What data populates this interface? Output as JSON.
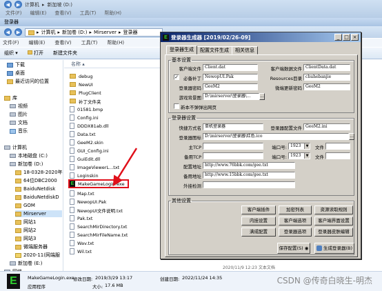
{
  "prev_window": {
    "breadcrumb": [
      "计算机",
      "新加坡 (D:)"
    ],
    "menu": [
      "文件(F)",
      "编辑(E)",
      "查看(V)",
      "工具(T)",
      "帮助(H)"
    ]
  },
  "explorer": {
    "title": "登录器",
    "breadcrumb": [
      "计算机",
      "新加卷 (D:)",
      "Mirserver",
      "登录器"
    ],
    "menu": [
      "文件(F)",
      "编辑(E)",
      "查看(V)",
      "工具(T)",
      "帮助(H)"
    ],
    "toolbar": [
      "组织",
      "打开",
      "新建文件夹"
    ],
    "nav_items": [
      {
        "label": "下载",
        "icon": "folder-blue-icon"
      },
      {
        "label": "桌面",
        "icon": "folder-blue-icon"
      },
      {
        "label": "最近访问的位置",
        "icon": "folder-icon"
      },
      {
        "label": "库",
        "icon": "library-icon"
      },
      {
        "label": "视频",
        "icon": "video-icon"
      },
      {
        "label": "图片",
        "icon": "picture-icon"
      },
      {
        "label": "文档",
        "icon": "document-icon"
      },
      {
        "label": "音乐",
        "icon": "music-icon"
      },
      {
        "label": "计算机",
        "icon": "computer-icon"
      },
      {
        "label": "本地磁盘 (C:)",
        "icon": "drive-icon"
      },
      {
        "label": "新加卷 (D:)",
        "icon": "drive-icon"
      },
      {
        "label": "18-0328-2020年",
        "icon": "folder-icon"
      },
      {
        "label": "64位DBC2000",
        "icon": "folder-icon"
      },
      {
        "label": "BaiduNetdisk",
        "icon": "folder-icon"
      },
      {
        "label": "BaiduNetdiskD",
        "icon": "folder-icon"
      },
      {
        "label": "GOM",
        "icon": "folder-icon"
      },
      {
        "label": "Mirserver",
        "icon": "folder-icon",
        "selected": true
      },
      {
        "label": "网站1",
        "icon": "folder-icon"
      },
      {
        "label": "网站2",
        "icon": "folder-icon"
      },
      {
        "label": "网站3",
        "icon": "folder-icon"
      },
      {
        "label": "微端服务器",
        "icon": "folder-icon"
      },
      {
        "label": "2020-11(网端服",
        "icon": "folder-icon"
      },
      {
        "label": "新加卷 (E:)",
        "icon": "drive-icon"
      },
      {
        "label": "网络",
        "icon": "network-icon"
      }
    ],
    "column_header": "名称",
    "files": [
      {
        "name": "debug",
        "type": "folder"
      },
      {
        "name": "NewUI",
        "type": "folder"
      },
      {
        "name": "PlugClient",
        "type": "folder"
      },
      {
        "name": "补丁文件夹",
        "type": "folder"
      },
      {
        "name": "01581.bmp",
        "type": "file"
      },
      {
        "name": "Config.ini",
        "type": "file"
      },
      {
        "name": "DDDX81ab.dll",
        "type": "file"
      },
      {
        "name": "Data.txt",
        "type": "file"
      },
      {
        "name": "GeeM2.skin",
        "type": "file"
      },
      {
        "name": "GUI_Config.ini",
        "type": "file"
      },
      {
        "name": "GuiEdit.dll",
        "type": "file"
      },
      {
        "name": "ImageViewerL...txt",
        "type": "file"
      },
      {
        "name": "Loginskin",
        "type": "file"
      },
      {
        "name": "MakeGameLogin.exe",
        "type": "exe",
        "highlighted": true
      },
      {
        "name": "Map.txt",
        "type": "file"
      },
      {
        "name": "NewopUI.Pak",
        "type": "file"
      },
      {
        "name": "NewopUI文件说明.txt",
        "type": "file"
      },
      {
        "name": "Pak.txt",
        "type": "file"
      },
      {
        "name": "SearchMirDirectory.txt",
        "type": "file"
      },
      {
        "name": "SearchMirFileName.txt",
        "type": "file"
      },
      {
        "name": "Wav.txt",
        "type": "file"
      },
      {
        "name": "Wil.txt",
        "type": "file"
      }
    ],
    "peek_text": "2020/11/9 12:23  文本文档",
    "status": {
      "filename": "MakeGameLogin.exe",
      "modified_label": "修改日期:",
      "modified": "2019/3/29 13:17",
      "created_label": "创建日期:",
      "created": "2022/11/24 14:35",
      "type": "应用程序",
      "size_label": "大小:",
      "size": "17.6 MB"
    },
    "watermark": "CSDN @传奇白晓生-明杰"
  },
  "dialog": {
    "title": "登录器生成器 [2019/02/26-09]",
    "win_buttons": [
      "_",
      "□",
      "×"
    ],
    "tabs": [
      "登录器生成",
      "配置文件生成",
      "相关信息"
    ],
    "basic_group": "基本设置",
    "client_file_label": "客户端文件",
    "client_file": "Client.dat",
    "client_data_label": "客户端数据文件",
    "client_data": "ClientData.dat",
    "patch_checked": true,
    "patch_label": "必备补丁",
    "patch_value": "NewopUI.Pak",
    "resources_label": "Resources目录",
    "resources_value": "chuhebanjie",
    "login_pwd_label": "登录器密码",
    "login_pwd": "GeeM2",
    "micro_pwd_label": "微端更新密码",
    "micro_pwd": "GeeM2",
    "bg_label": "游戏背景图",
    "bg_value": "D:\\mirserver\\登录器\\...",
    "browse": "...",
    "no_popup_label": "新本不弹弹出网页",
    "login_group": "登录器设置",
    "shortcut_label": "快捷方式名",
    "shortcut_value": "单机登录器",
    "config_file_label": "登录器配置文件",
    "config_file_value": "GeeM2.ini",
    "icon_label": "登录器图标",
    "icon_value": "D:\\mirserver\\登录器\\红色.ico",
    "main_tcp_label": "主TCP",
    "main_port_label": "端口号:",
    "main_port": "1923",
    "file_label": "文件",
    "backup_tcp_label": "备用TCP",
    "backup_port_label": "端口号:",
    "backup_port": "1923",
    "config_addr_label": "配置地址",
    "config_addr": "http://www.76bbk.com/gee.txt",
    "backup_addr_label": "备用地址",
    "backup_addr": "http://www.15bbk.com/gee.txt",
    "plugin_label": "外挂检测",
    "other_group": "其他设置",
    "buttons": [
      "客户端插件",
      "加密列表",
      "资源读取规则",
      "内挂设置",
      "客户端选项",
      "客户端界面设置",
      "满成配置",
      "登录器选项",
      "登录器皮肤编辑"
    ],
    "save_config": "保存配置(S)",
    "generate": "生成登录器(B)"
  }
}
